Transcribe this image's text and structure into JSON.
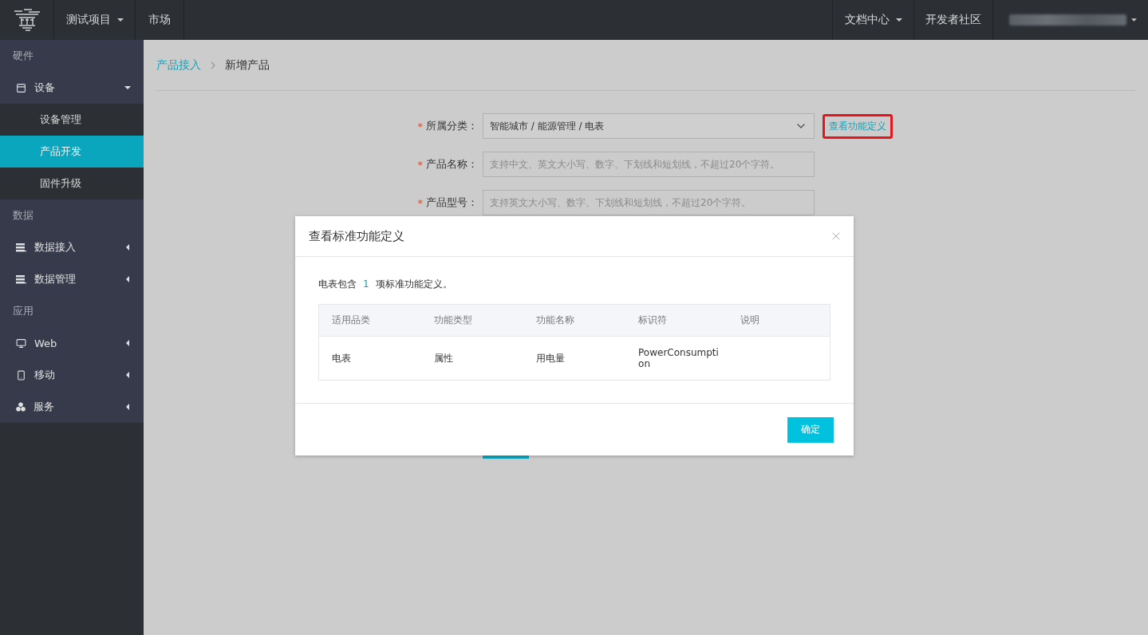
{
  "topbar": {
    "project": "测试项目",
    "market": "市场",
    "docs": "文档中心",
    "community": "开发者社区"
  },
  "sidebar": {
    "sections": [
      {
        "title": "硬件",
        "items": [
          {
            "label": "设备",
            "kind": "device",
            "expanded": true,
            "children": [
              {
                "label": "设备管理",
                "selected": false
              },
              {
                "label": "产品开发",
                "selected": true
              },
              {
                "label": "固件升级",
                "selected": false
              }
            ]
          }
        ]
      },
      {
        "title": "数据",
        "items": [
          {
            "label": "数据接入",
            "kind": "data",
            "expanded": false
          },
          {
            "label": "数据管理",
            "kind": "data",
            "expanded": false
          }
        ]
      },
      {
        "title": "应用",
        "items": [
          {
            "label": "Web",
            "kind": "monitor",
            "expanded": false
          },
          {
            "label": "移动",
            "kind": "phone",
            "expanded": false
          },
          {
            "label": "服务",
            "kind": "cluster",
            "expanded": false
          }
        ]
      }
    ]
  },
  "breadcrumb": [
    {
      "label": "产品接入",
      "kind": "link"
    },
    {
      "label": "新增产品",
      "kind": "current"
    }
  ],
  "form": {
    "fields": [
      {
        "kind": "select",
        "mark": "*",
        "label": "所属分类：",
        "value": "智能城市 / 能源管理 / 电表",
        "link": {
          "label": "查看功能定义",
          "highlighted": true
        }
      },
      {
        "kind": "text",
        "mark": "*",
        "label": "产品名称：",
        "placeholder": "支持中文、英文大小写、数字、下划线和短划线，不超过20个字符。"
      },
      {
        "kind": "text",
        "mark": "*",
        "label": "产品型号：",
        "placeholder": "支持英文大小写、数字、下划线和短划线，不超过20个字符。"
      }
    ]
  },
  "dialog": {
    "title": "查看标准功能定义",
    "summary": {
      "before": "电表包含",
      "count": "1",
      "after": "项标准功能定义。"
    },
    "table": {
      "columns": [
        "适用品类",
        "功能类型",
        "功能名称",
        "标识符",
        "说明"
      ],
      "rows": [
        [
          "电表",
          "属性",
          "用电量",
          "PowerConsumpti\non",
          ""
        ]
      ]
    },
    "ok_button": "确定"
  }
}
